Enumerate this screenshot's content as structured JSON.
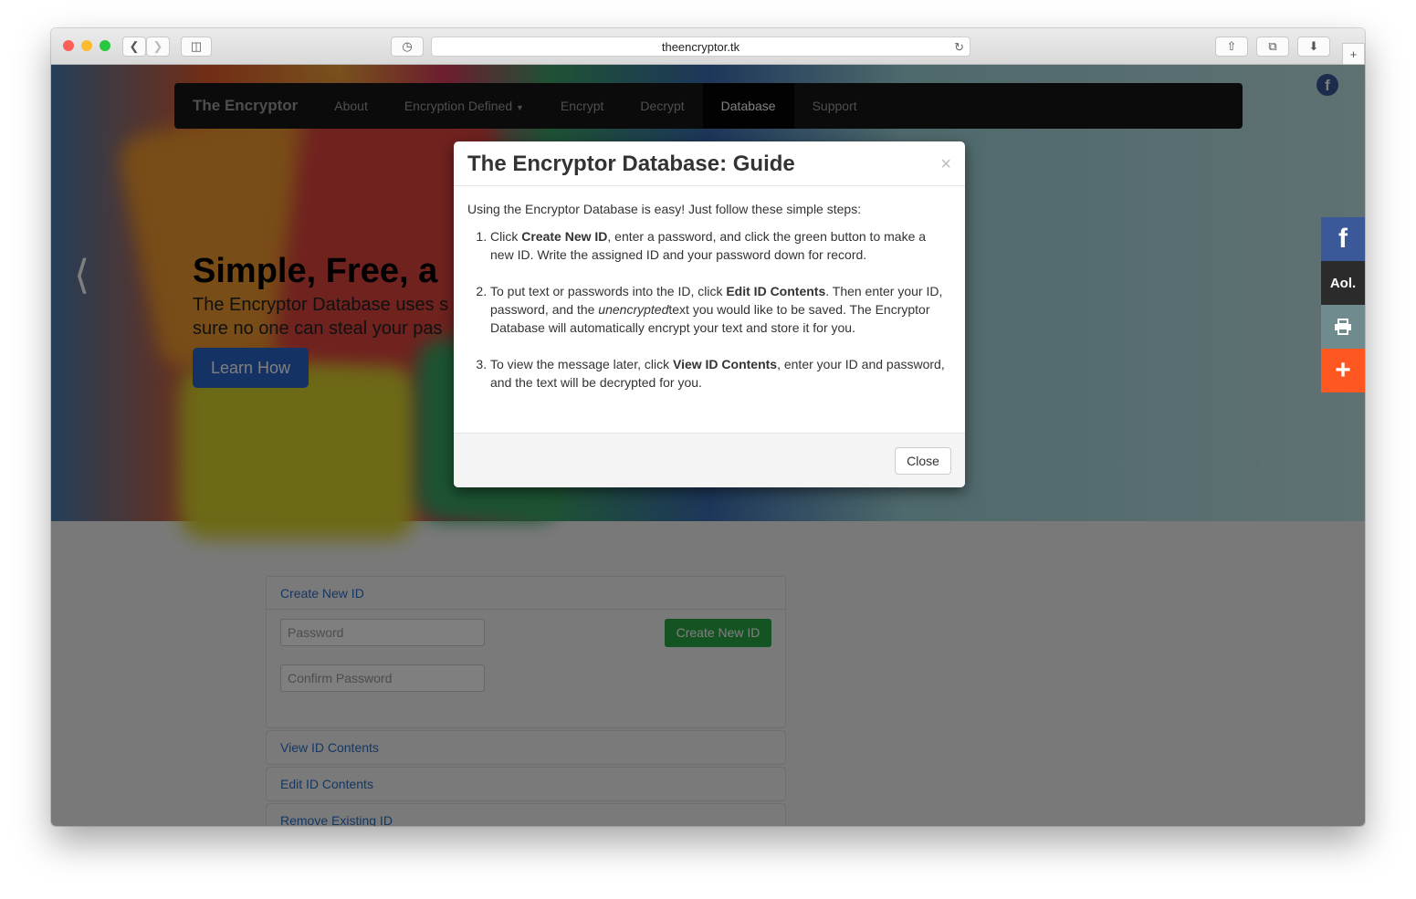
{
  "browser": {
    "url": "theencryptor.tk"
  },
  "nav": {
    "brand": "The Encryptor",
    "items": [
      {
        "label": "About"
      },
      {
        "label": "Encryption Defined"
      },
      {
        "label": "Encrypt"
      },
      {
        "label": "Decrypt"
      },
      {
        "label": "Database"
      },
      {
        "label": "Support"
      }
    ]
  },
  "hero": {
    "title": "Simple, Free, a",
    "text_line1": "The Encryptor Database uses s",
    "text_line2": "sure no one can steal your pas",
    "button": "Learn How"
  },
  "share": {
    "aol": "Aol.",
    "colors": {
      "facebook": "#3b5998",
      "aol": "#2b2b2b",
      "print": "#6f8b8e",
      "plus": "#ff5722"
    }
  },
  "panels": {
    "create": "Create New ID",
    "password_placeholder": "Password",
    "confirm_placeholder": "Confirm Password",
    "create_button": "Create New ID",
    "view": "View ID Contents",
    "edit": "Edit ID Contents",
    "remove": "Remove Existing ID"
  },
  "modal": {
    "title": "The Encryptor Database: Guide",
    "intro": "Using the Encryptor Database is easy! Just follow these simple steps:",
    "step1": {
      "a": "Click ",
      "b": "Create New ID",
      "c": ", enter a password, and click the green button to make a new ID. Write the assigned ID and your password down for record."
    },
    "step2": {
      "a": "To put text or passwords into the ID, click ",
      "b": "Edit ID Contents",
      "c": ". Then enter your ID, password, and the ",
      "d": "unencrypted",
      "e": "text you would like to be saved. The Encryptor Database will automatically encrypt your text and store it for you."
    },
    "step3": {
      "a": "To view the message later, click ",
      "b": "View ID Contents",
      "c": ", enter your ID and password, and the text will be decrypted for you."
    },
    "close": "Close"
  }
}
